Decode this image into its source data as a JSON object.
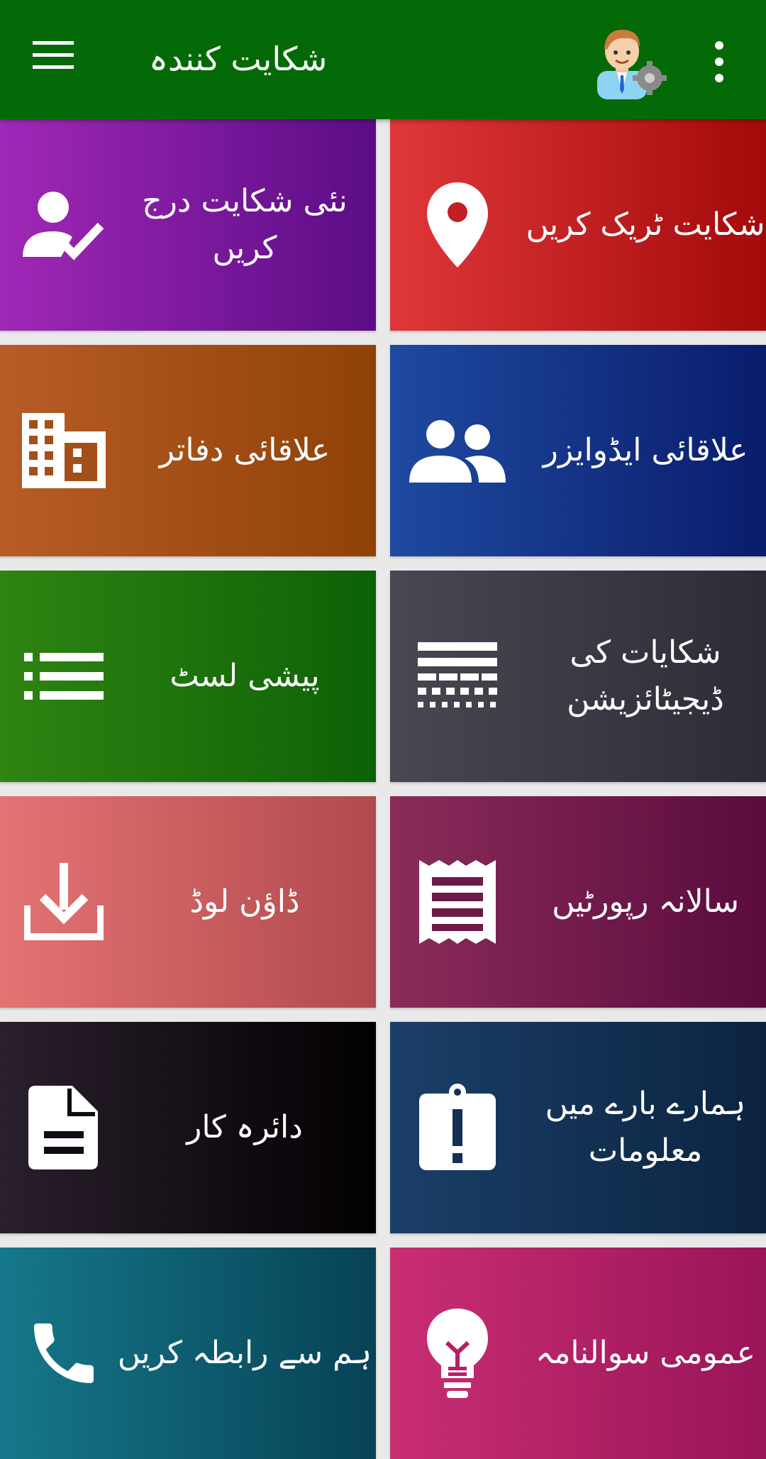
{
  "appbar": {
    "title": "شکایت کنندہ",
    "menu_icon": "hamburger-menu-icon",
    "avatar_icon": "user-settings-avatar",
    "overflow_icon": "more-vert-icon",
    "bg": "#046a07"
  },
  "tiles": [
    {
      "label": "نئی شکایت درج کریں",
      "icon": "person-check-icon",
      "colors": [
        "#a028b6",
        "#5b0c86"
      ]
    },
    {
      "label": "شکایت ٹریک کریں",
      "icon": "location-pin-icon",
      "colors": [
        "#e0373a",
        "#a30a0a"
      ]
    },
    {
      "label": "علاقائی دفاتر",
      "icon": "building-icon",
      "colors": [
        "#b85c28",
        "#8f4206"
      ]
    },
    {
      "label": "علاقائی ایڈوایزر",
      "icon": "people-icon",
      "colors": [
        "#1e4aa0",
        "#0a1c6c"
      ]
    },
    {
      "label": "پیشی لسٹ",
      "icon": "list-icon",
      "colors": [
        "#2f8412",
        "#0d6106"
      ]
    },
    {
      "label": "شکایات کی ڈیجیٹائزیشن",
      "icon": "digitization-icon",
      "colors": [
        "#4a4652",
        "#2e2b36"
      ]
    },
    {
      "label": "ڈاؤن لوڈ",
      "icon": "download-icon",
      "colors": [
        "#e57373",
        "#b04a4e"
      ]
    },
    {
      "label": "سالانہ رپورٹیں",
      "icon": "receipt-icon",
      "colors": [
        "#8a2c5a",
        "#5a0b3e"
      ]
    },
    {
      "label": "دائرہ کار",
      "icon": "document-icon",
      "colors": [
        "#2a1f2c",
        "#020002"
      ]
    },
    {
      "label": "ہمارے بارے میں معلومات",
      "icon": "info-clipboard-icon",
      "colors": [
        "#1b3f68",
        "#0b2340"
      ]
    },
    {
      "label": "ہم سے رابطہ کریں",
      "icon": "phone-icon",
      "colors": [
        "#15788a",
        "#074255"
      ]
    },
    {
      "label": "عمومی سوالنامہ",
      "icon": "lightbulb-icon",
      "colors": [
        "#c92e73",
        "#9a1459"
      ]
    }
  ]
}
